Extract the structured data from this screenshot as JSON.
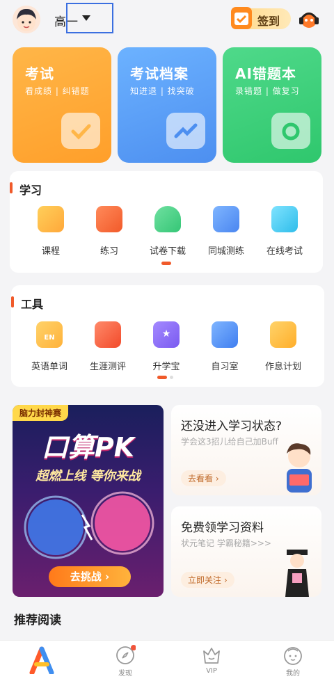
{
  "header": {
    "grade": "高一",
    "signin_label": "签到"
  },
  "cards": [
    {
      "title": "考试",
      "subtitle": "看成绩 | 纠错题",
      "icon": "check-icon",
      "color": "#ffab3a"
    },
    {
      "title": "考试档案",
      "subtitle": "知进退 | 找突破",
      "icon": "trend-folder-icon",
      "color": "#5aa3f5"
    },
    {
      "title": "AI错题本",
      "subtitle": "录错题 | 做复习",
      "icon": "camera-icon",
      "color": "#45cf7a"
    }
  ],
  "study": {
    "title": "学习",
    "items": [
      {
        "label": "课程",
        "icon": "video-icon"
      },
      {
        "label": "练习",
        "icon": "pencil-doc-icon"
      },
      {
        "label": "试卷下载",
        "icon": "cloud-download-icon"
      },
      {
        "label": "同城测练",
        "icon": "check-doc-icon"
      },
      {
        "label": "在线考试",
        "icon": "folder-icon"
      }
    ]
  },
  "tools": {
    "title": "工具",
    "items": [
      {
        "label": "英语单词",
        "icon": "en-icon"
      },
      {
        "label": "生涯测评",
        "icon": "report-icon"
      },
      {
        "label": "升学宝",
        "icon": "star-book-icon"
      },
      {
        "label": "自习室",
        "icon": "document-icon"
      },
      {
        "label": "作息计划",
        "icon": "calendar-icon"
      }
    ]
  },
  "banner": {
    "tag": "脑力封神赛",
    "title": "口算PK",
    "subtitle": "超燃上线 等你来战",
    "button": "去挑战"
  },
  "info_cards": [
    {
      "title": "还没进入学习状态?",
      "subtitle": "学会这3招儿给自己加Buff",
      "button": "去看看"
    },
    {
      "title": "免费领学习资料",
      "subtitle": "状元笔记 学霸秘籍>>>",
      "button": "立即关注"
    }
  ],
  "recommend_title": "推荐阅读",
  "nav": [
    {
      "label": "",
      "icon": "app-logo-icon"
    },
    {
      "label": "发现",
      "icon": "compass-icon"
    },
    {
      "label": "VIP",
      "icon": "crown-icon"
    },
    {
      "label": "我的",
      "icon": "face-icon"
    }
  ]
}
